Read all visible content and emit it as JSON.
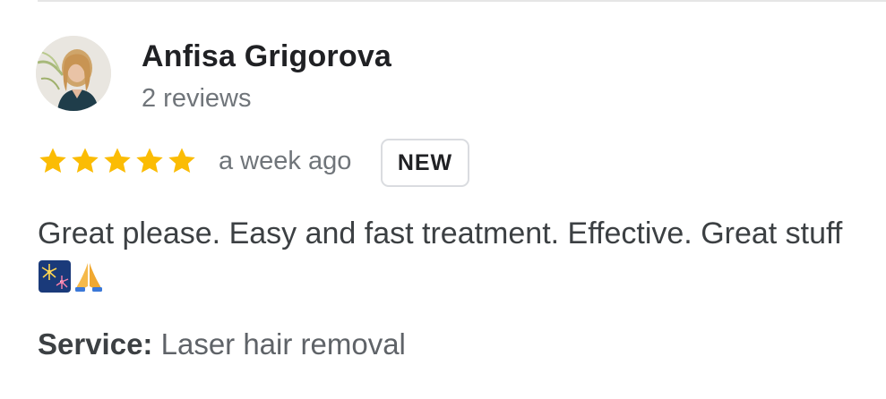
{
  "reviewer": {
    "name": "Anfisa Grigorova",
    "review_count": "2 reviews",
    "avatar_icon": "profile-photo"
  },
  "rating": {
    "stars": 5,
    "max_stars": 5,
    "star_color": "#fbbc04"
  },
  "review": {
    "time_ago": "a week ago",
    "badge": "NEW",
    "text": "Great please. Easy and fast treatment. Effective. Great stuff",
    "emojis": [
      "fireworks-icon",
      "folded-hands-icon"
    ]
  },
  "service": {
    "label": "Service:",
    "value": "Laser hair removal"
  }
}
